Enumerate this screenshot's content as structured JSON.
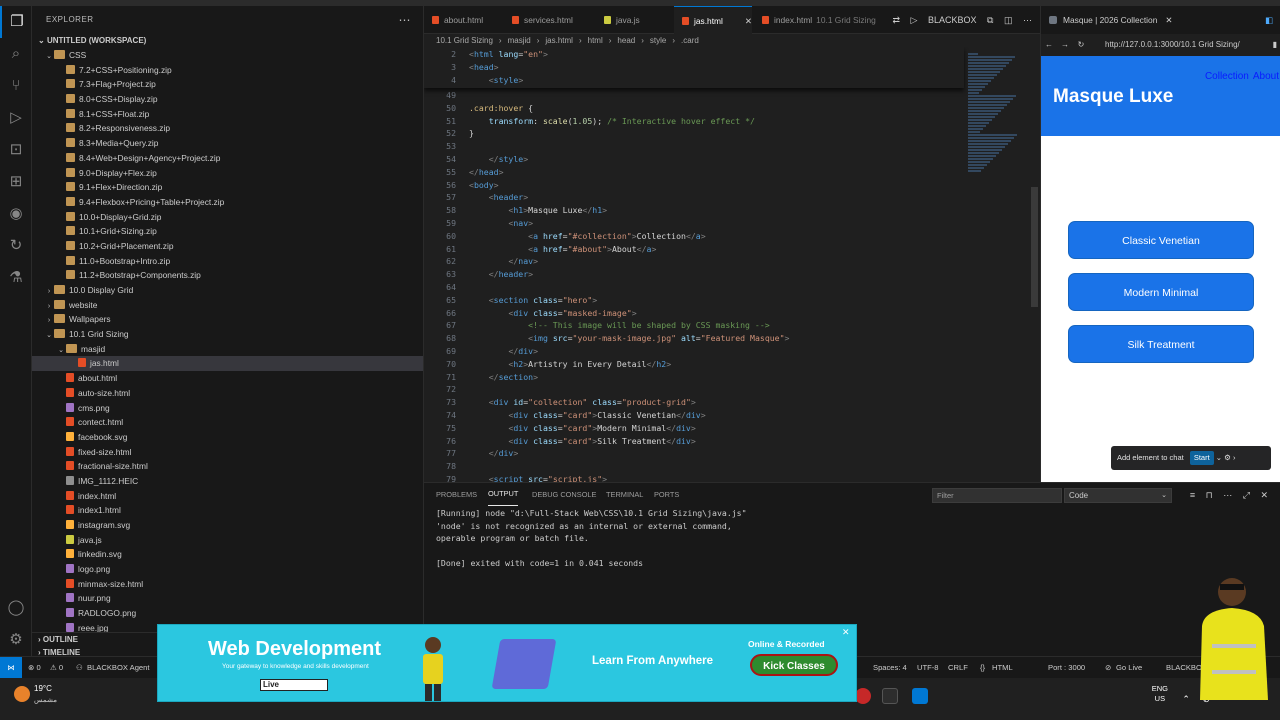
{
  "explorer": {
    "title": "EXPLORER",
    "workspace": "UNTITLED (WORKSPACE)",
    "tree": [
      {
        "depth": 1,
        "kind": "folder",
        "open": true,
        "label": "CSS"
      },
      {
        "depth": 2,
        "kind": "zip",
        "label": "7.2+CSS+Positioning.zip"
      },
      {
        "depth": 2,
        "kind": "zip",
        "label": "7.3+Flag+Project.zip"
      },
      {
        "depth": 2,
        "kind": "zip",
        "label": "8.0+CSS+Display.zip"
      },
      {
        "depth": 2,
        "kind": "zip",
        "label": "8.1+CSS+Float.zip"
      },
      {
        "depth": 2,
        "kind": "zip",
        "label": "8.2+Responsiveness.zip"
      },
      {
        "depth": 2,
        "kind": "zip",
        "label": "8.3+Media+Query.zip"
      },
      {
        "depth": 2,
        "kind": "zip",
        "label": "8.4+Web+Design+Agency+Project.zip"
      },
      {
        "depth": 2,
        "kind": "zip",
        "label": "9.0+Display+Flex.zip"
      },
      {
        "depth": 2,
        "kind": "zip",
        "label": "9.1+Flex+Direction.zip"
      },
      {
        "depth": 2,
        "kind": "zip",
        "label": "9.4+Flexbox+Pricing+Table+Project.zip"
      },
      {
        "depth": 2,
        "kind": "zip",
        "label": "10.0+Display+Grid.zip"
      },
      {
        "depth": 2,
        "kind": "zip",
        "label": "10.1+Grid+Sizing.zip"
      },
      {
        "depth": 2,
        "kind": "zip",
        "label": "10.2+Grid+Placement.zip"
      },
      {
        "depth": 2,
        "kind": "zip",
        "label": "11.0+Bootstrap+Intro.zip"
      },
      {
        "depth": 2,
        "kind": "zip",
        "label": "11.2+Bootstrap+Components.zip"
      },
      {
        "depth": 1,
        "kind": "folder",
        "open": false,
        "label": "10.0 Display Grid"
      },
      {
        "depth": 1,
        "kind": "folder",
        "open": false,
        "label": "website"
      },
      {
        "depth": 1,
        "kind": "folder",
        "open": false,
        "label": "Wallpapers"
      },
      {
        "depth": 1,
        "kind": "folder",
        "open": true,
        "label": "10.1 Grid Sizing"
      },
      {
        "depth": 2,
        "kind": "folder",
        "open": true,
        "label": "masjid"
      },
      {
        "depth": 3,
        "kind": "html",
        "label": "jas.html",
        "selected": true
      },
      {
        "depth": 2,
        "kind": "html",
        "label": "about.html"
      },
      {
        "depth": 2,
        "kind": "html",
        "label": "auto-size.html"
      },
      {
        "depth": 2,
        "kind": "img",
        "label": "cms.png"
      },
      {
        "depth": 2,
        "kind": "html",
        "label": "contect.html"
      },
      {
        "depth": 2,
        "kind": "svg",
        "label": "facebook.svg"
      },
      {
        "depth": 2,
        "kind": "html",
        "label": "fixed-size.html"
      },
      {
        "depth": 2,
        "kind": "html",
        "label": "fractional-size.html"
      },
      {
        "depth": 2,
        "kind": "heic",
        "label": "IMG_1112.HEIC"
      },
      {
        "depth": 2,
        "kind": "html",
        "label": "index.html"
      },
      {
        "depth": 2,
        "kind": "html",
        "label": "index1.html"
      },
      {
        "depth": 2,
        "kind": "svg",
        "label": "instagram.svg"
      },
      {
        "depth": 2,
        "kind": "js",
        "label": "java.js"
      },
      {
        "depth": 2,
        "kind": "svg",
        "label": "linkedin.svg"
      },
      {
        "depth": 2,
        "kind": "img",
        "label": "logo.png"
      },
      {
        "depth": 2,
        "kind": "html",
        "label": "minmax-size.html"
      },
      {
        "depth": 2,
        "kind": "img",
        "label": "nuur.png"
      },
      {
        "depth": 2,
        "kind": "img",
        "label": "RADLOGO.png"
      },
      {
        "depth": 2,
        "kind": "img",
        "label": "reee.jpg"
      }
    ],
    "outline_label": "OUTLINE",
    "timeline_label": "TIMELINE"
  },
  "tabs": [
    {
      "label": "about.html",
      "icon": "html",
      "active": false,
      "desc": ""
    },
    {
      "label": "services.html",
      "icon": "html",
      "active": false,
      "desc": ""
    },
    {
      "label": "java.js",
      "icon": "js",
      "active": false,
      "desc": ""
    },
    {
      "label": "jas.html",
      "icon": "html",
      "active": true,
      "desc": ""
    },
    {
      "label": "index.html",
      "icon": "html",
      "active": false,
      "desc": "10.1 Grid Sizing"
    }
  ],
  "tab_close": "✕",
  "blackbox_label": "BLACKBOX",
  "breadcrumbs": [
    "10.1 Grid Sizing",
    "masjid",
    "jas.html",
    "html",
    "head",
    "style",
    ".card"
  ],
  "sticky_lines": [
    {
      "n": "2",
      "code": [
        [
          "t-br",
          "<"
        ],
        [
          "t-tag",
          "html "
        ],
        [
          "t-at",
          "lang"
        ],
        [
          "",
          "="
        ],
        [
          "t-st",
          "\"en\""
        ],
        [
          "t-br",
          ">"
        ]
      ]
    },
    {
      "n": "3",
      "code": [
        [
          "t-br",
          "<"
        ],
        [
          "t-tag",
          "head"
        ],
        [
          "t-br",
          ">"
        ]
      ]
    },
    {
      "n": "4",
      "code": [
        [
          "",
          "    "
        ],
        [
          "t-br",
          "<"
        ],
        [
          "t-tag",
          "style"
        ],
        [
          "t-br",
          ">"
        ]
      ]
    }
  ],
  "code_lines": [
    {
      "n": "49",
      "code": []
    },
    {
      "n": "50",
      "code": [
        [
          "t-sel",
          ".card:hover "
        ],
        [
          "",
          "{"
        ]
      ]
    },
    {
      "n": "51",
      "code": [
        [
          "",
          "    "
        ],
        [
          "t-pr",
          "transform"
        ],
        [
          "",
          ": "
        ],
        [
          "t-fn",
          "scale"
        ],
        [
          "",
          "("
        ],
        [
          "t-num",
          "1.05"
        ],
        [
          "",
          "); "
        ],
        [
          "t-cm",
          "/* Interactive hover effect */"
        ]
      ]
    },
    {
      "n": "52",
      "code": [
        [
          "",
          "}"
        ]
      ]
    },
    {
      "n": "53",
      "code": []
    },
    {
      "n": "54",
      "code": [
        [
          "",
          "    "
        ],
        [
          "t-br",
          "</"
        ],
        [
          "t-tag",
          "style"
        ],
        [
          "t-br",
          ">"
        ]
      ]
    },
    {
      "n": "55",
      "code": [
        [
          "t-br",
          "</"
        ],
        [
          "t-tag",
          "head"
        ],
        [
          "t-br",
          ">"
        ]
      ]
    },
    {
      "n": "56",
      "code": [
        [
          "t-br",
          "<"
        ],
        [
          "t-tag",
          "body"
        ],
        [
          "t-br",
          ">"
        ]
      ]
    },
    {
      "n": "57",
      "code": [
        [
          "",
          "    "
        ],
        [
          "t-br",
          "<"
        ],
        [
          "t-tag",
          "header"
        ],
        [
          "t-br",
          ">"
        ]
      ]
    },
    {
      "n": "58",
      "code": [
        [
          "",
          "        "
        ],
        [
          "t-br",
          "<"
        ],
        [
          "t-tag",
          "h1"
        ],
        [
          "t-br",
          ">"
        ],
        [
          "",
          "Masque Luxe"
        ],
        [
          "t-br",
          "</"
        ],
        [
          "t-tag",
          "h1"
        ],
        [
          "t-br",
          ">"
        ]
      ]
    },
    {
      "n": "59",
      "code": [
        [
          "",
          "        "
        ],
        [
          "t-br",
          "<"
        ],
        [
          "t-tag",
          "nav"
        ],
        [
          "t-br",
          ">"
        ]
      ]
    },
    {
      "n": "60",
      "code": [
        [
          "",
          "            "
        ],
        [
          "t-br",
          "<"
        ],
        [
          "t-tag",
          "a "
        ],
        [
          "t-at",
          "href"
        ],
        [
          "",
          "="
        ],
        [
          "t-st",
          "\"#collection\""
        ],
        [
          "t-br",
          ">"
        ],
        [
          "",
          "Collection"
        ],
        [
          "t-br",
          "</"
        ],
        [
          "t-tag",
          "a"
        ],
        [
          "t-br",
          ">"
        ]
      ]
    },
    {
      "n": "61",
      "code": [
        [
          "",
          "            "
        ],
        [
          "t-br",
          "<"
        ],
        [
          "t-tag",
          "a "
        ],
        [
          "t-at",
          "href"
        ],
        [
          "",
          "="
        ],
        [
          "t-st",
          "\"#about\""
        ],
        [
          "t-br",
          ">"
        ],
        [
          "",
          "About"
        ],
        [
          "t-br",
          "</"
        ],
        [
          "t-tag",
          "a"
        ],
        [
          "t-br",
          ">"
        ]
      ]
    },
    {
      "n": "62",
      "code": [
        [
          "",
          "        "
        ],
        [
          "t-br",
          "</"
        ],
        [
          "t-tag",
          "nav"
        ],
        [
          "t-br",
          ">"
        ]
      ]
    },
    {
      "n": "63",
      "code": [
        [
          "",
          "    "
        ],
        [
          "t-br",
          "</"
        ],
        [
          "t-tag",
          "header"
        ],
        [
          "t-br",
          ">"
        ]
      ]
    },
    {
      "n": "64",
      "code": []
    },
    {
      "n": "65",
      "code": [
        [
          "",
          "    "
        ],
        [
          "t-br",
          "<"
        ],
        [
          "t-tag",
          "section "
        ],
        [
          "t-at",
          "class"
        ],
        [
          "",
          "="
        ],
        [
          "t-st",
          "\"hero\""
        ],
        [
          "t-br",
          ">"
        ]
      ]
    },
    {
      "n": "66",
      "code": [
        [
          "",
          "        "
        ],
        [
          "t-br",
          "<"
        ],
        [
          "t-tag",
          "div "
        ],
        [
          "t-at",
          "class"
        ],
        [
          "",
          "="
        ],
        [
          "t-st",
          "\"masked-image\""
        ],
        [
          "t-br",
          ">"
        ]
      ]
    },
    {
      "n": "67",
      "code": [
        [
          "",
          "            "
        ],
        [
          "t-cm",
          "<!-- This image will be shaped by CSS masking -->"
        ]
      ]
    },
    {
      "n": "68",
      "code": [
        [
          "",
          "            "
        ],
        [
          "t-br",
          "<"
        ],
        [
          "t-tag",
          "img "
        ],
        [
          "t-at",
          "src"
        ],
        [
          "",
          "="
        ],
        [
          "t-st",
          "\"your-mask-image.jpg\""
        ],
        [
          "",
          " "
        ],
        [
          "t-at",
          "alt"
        ],
        [
          "",
          "="
        ],
        [
          "t-st",
          "\"Featured Masque\""
        ],
        [
          "t-br",
          ">"
        ]
      ]
    },
    {
      "n": "69",
      "code": [
        [
          "",
          "        "
        ],
        [
          "t-br",
          "</"
        ],
        [
          "t-tag",
          "div"
        ],
        [
          "t-br",
          ">"
        ]
      ]
    },
    {
      "n": "70",
      "code": [
        [
          "",
          "        "
        ],
        [
          "t-br",
          "<"
        ],
        [
          "t-tag",
          "h2"
        ],
        [
          "t-br",
          ">"
        ],
        [
          "",
          "Artistry in Every Detail"
        ],
        [
          "t-br",
          "</"
        ],
        [
          "t-tag",
          "h2"
        ],
        [
          "t-br",
          ">"
        ]
      ]
    },
    {
      "n": "71",
      "code": [
        [
          "",
          "    "
        ],
        [
          "t-br",
          "</"
        ],
        [
          "t-tag",
          "section"
        ],
        [
          "t-br",
          ">"
        ]
      ]
    },
    {
      "n": "72",
      "code": []
    },
    {
      "n": "73",
      "code": [
        [
          "",
          "    "
        ],
        [
          "t-br",
          "<"
        ],
        [
          "t-tag",
          "div "
        ],
        [
          "t-at",
          "id"
        ],
        [
          "",
          "="
        ],
        [
          "t-st",
          "\"collection\""
        ],
        [
          "",
          " "
        ],
        [
          "t-at",
          "class"
        ],
        [
          "",
          "="
        ],
        [
          "t-st",
          "\"product-grid\""
        ],
        [
          "t-br",
          ">"
        ]
      ]
    },
    {
      "n": "74",
      "code": [
        [
          "",
          "        "
        ],
        [
          "t-br",
          "<"
        ],
        [
          "t-tag",
          "div "
        ],
        [
          "t-at",
          "class"
        ],
        [
          "",
          "="
        ],
        [
          "t-st",
          "\"card\""
        ],
        [
          "t-br",
          ">"
        ],
        [
          "",
          "Classic Venetian"
        ],
        [
          "t-br",
          "</"
        ],
        [
          "t-tag",
          "div"
        ],
        [
          "t-br",
          ">"
        ]
      ]
    },
    {
      "n": "75",
      "code": [
        [
          "",
          "        "
        ],
        [
          "t-br",
          "<"
        ],
        [
          "t-tag",
          "div "
        ],
        [
          "t-at",
          "class"
        ],
        [
          "",
          "="
        ],
        [
          "t-st",
          "\"card\""
        ],
        [
          "t-br",
          ">"
        ],
        [
          "",
          "Modern Minimal"
        ],
        [
          "t-br",
          "</"
        ],
        [
          "t-tag",
          "div"
        ],
        [
          "t-br",
          ">"
        ]
      ]
    },
    {
      "n": "76",
      "code": [
        [
          "",
          "        "
        ],
        [
          "t-br",
          "<"
        ],
        [
          "t-tag",
          "div "
        ],
        [
          "t-at",
          "class"
        ],
        [
          "",
          "="
        ],
        [
          "t-st",
          "\"card\""
        ],
        [
          "t-br",
          ">"
        ],
        [
          "",
          "Silk Treatment"
        ],
        [
          "t-br",
          "</"
        ],
        [
          "t-tag",
          "div"
        ],
        [
          "t-br",
          ">"
        ]
      ]
    },
    {
      "n": "77",
      "code": [
        [
          "",
          "    "
        ],
        [
          "t-br",
          "</"
        ],
        [
          "t-tag",
          "div"
        ],
        [
          "t-br",
          ">"
        ]
      ]
    },
    {
      "n": "78",
      "code": []
    },
    {
      "n": "79",
      "code": [
        [
          "",
          "    "
        ],
        [
          "t-br",
          "<"
        ],
        [
          "t-tag",
          "script "
        ],
        [
          "t-at",
          "src"
        ],
        [
          "",
          "="
        ],
        [
          "t-st",
          "\"script.js\""
        ],
        [
          "t-br",
          ">"
        ]
      ]
    }
  ],
  "panel": {
    "tabs": [
      "PROBLEMS",
      "OUTPUT",
      "DEBUG CONSOLE",
      "TERMINAL",
      "PORTS"
    ],
    "active_tab": "OUTPUT",
    "filter_placeholder": "Filter",
    "channel": "Code",
    "output_lines": [
      "[Running] node \"d:\\Full-Stack Web\\CSS\\10.1 Grid Sizing\\java.js\"",
      "'node' is not recognized as an internal or external command,",
      "operable program or batch file.",
      "",
      "[Done] exited with code=1 in 0.041 seconds"
    ]
  },
  "browser": {
    "tab_title": "Masque | 2026 Collection",
    "url": "http://127.0.0.1:3000/10.1 Grid Sizing/",
    "page_title": "Masque Luxe",
    "nav": [
      "Collection",
      "About"
    ],
    "cards": [
      "Classic Venetian",
      "Modern Minimal",
      "Silk Treatment"
    ],
    "add_chat_label": "Add element to chat",
    "start_label": "Start"
  },
  "status": {
    "errors": "⊗ 0",
    "warnings": "⚠ 0",
    "blackbox_agent": "BLACKBOX Agent",
    "spaces": "Spaces: 4",
    "encoding": "UTF-8",
    "eol": "CRLF",
    "language": "HTML",
    "port": "Port : 3000",
    "golive": "Go Live",
    "blackbox": "BLACKBOX"
  },
  "taskbar": {
    "temp": "19°C",
    "weather_desc": "مشمس",
    "lang_top": "ENG",
    "lang_bottom": "US"
  },
  "ad": {
    "title": "Web Development",
    "subtitle": "Your gateway to knowledge and skills development",
    "live_word": "Live",
    "classes_word": "Classes",
    "learn": "Learn From Anywhere",
    "online": "Online & Recorded",
    "button": "Kick Classes"
  },
  "colors": {
    "accent": "#0078d4",
    "page_header": "#1a73e8",
    "ad_bg": "#2bc7e0",
    "ad_button": "#2e8b2e"
  }
}
